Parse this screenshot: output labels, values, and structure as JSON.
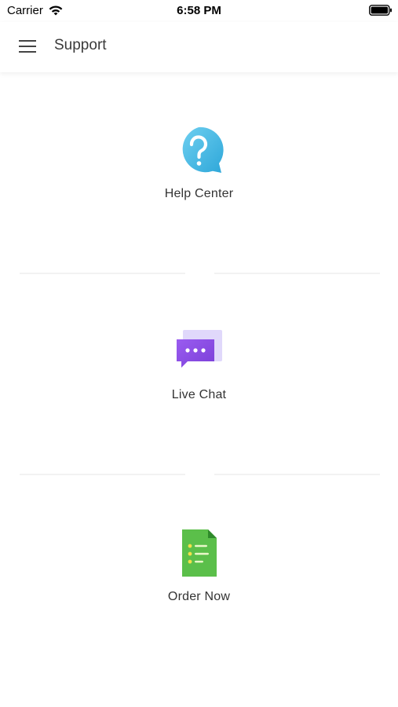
{
  "status_bar": {
    "carrier": "Carrier",
    "time": "6:58 PM"
  },
  "header": {
    "title": "Support"
  },
  "options": [
    {
      "label": "Help Center",
      "icon": "help-question-bubble-icon",
      "color": "#4cb9e4"
    },
    {
      "label": "Live Chat",
      "icon": "chat-bubble-icon",
      "color": "#8a4de0"
    },
    {
      "label": "Order Now",
      "icon": "order-form-document-icon",
      "color": "#5bbf4a"
    }
  ]
}
